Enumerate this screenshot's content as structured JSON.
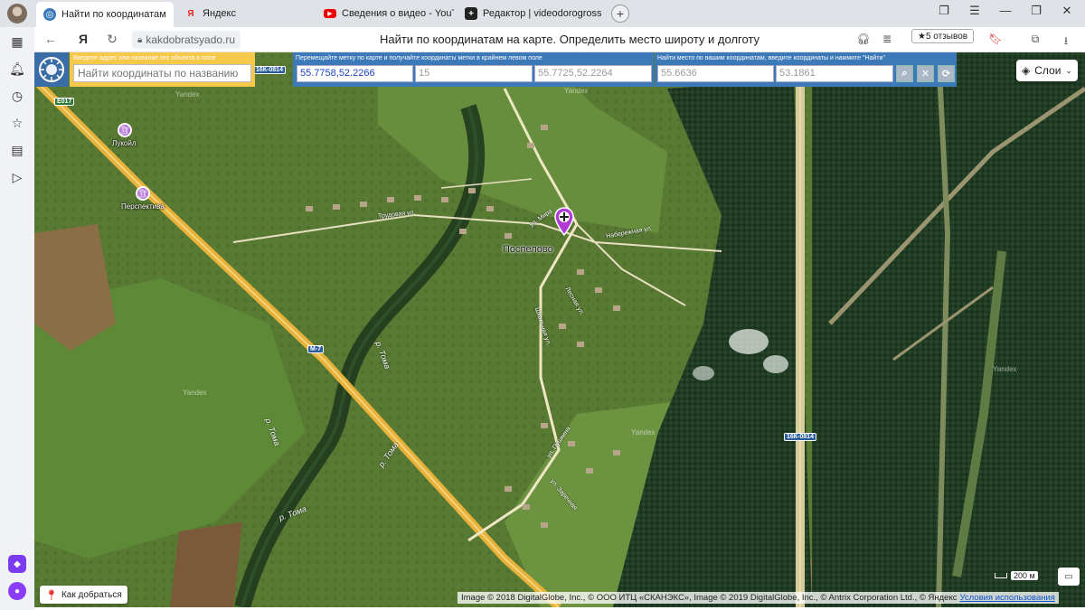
{
  "browser": {
    "tabs": [
      {
        "label": "Найти по координатам",
        "icon": "globe-icon",
        "active": true
      },
      {
        "label": "Яндекс",
        "icon": "yandex-icon",
        "active": false
      },
      {
        "label": "Сведения о видео - YouTu",
        "icon": "youtube-icon",
        "active": false
      },
      {
        "label": "Редактор | videodorogross",
        "icon": "editor-icon",
        "active": false
      }
    ],
    "new_tab_label": "+",
    "url": "kakdobratsyado.ru",
    "page_title": "Найти по координатам на карте. Определить место широту и долготу",
    "reviews": "★5 отзывов",
    "yandex_letter": "Я"
  },
  "toolbar": {
    "search_hint": "Введите адрес или название гео объекта в поле",
    "search_placeholder": "Найти координаты по названию",
    "move_hint": "Перемещайте метку по карте и получайте координаты метки в крайнем левом поле",
    "marker_coords": "55.7758,52.2266",
    "zoom": "15",
    "center_coords": "55.7725,52.2264",
    "find_hint": "Найти место по вашим координатам, введите координаты и нажмите \"Найти\"",
    "lat": "55.6636",
    "lon": "53.1861"
  },
  "map": {
    "layers_label": "Слои",
    "route_label": "Как добраться",
    "scale_label": "200 м",
    "copyright": "Image © 2018 DigitalGlobe, Inc., © ООО ИТЦ «СКАНЭКС», Image © 2019 DigitalGlobe, Inc., © Antrix Corporation Ltd., © Яндекс",
    "terms_link": "Условия использования",
    "labels": {
      "village": "Поспелово",
      "poi_lukoil": "Лукойл",
      "poi_perspektiva": "Перспектива",
      "road_m7": "М-7",
      "road_e017": "E017",
      "road_16k_top": "16К-0814",
      "road_16k_right": "16К-0814",
      "river_1": "р. Тома",
      "river_2": "р. Тома",
      "river_3": "р. Тома",
      "river_4": "р. Тома",
      "street_trudovaya": "Трудовая ул.",
      "street_mira": "ул. Мира",
      "street_naberezhnaya": "Набережная ул.",
      "street_lesnaya": "Лесная ул.",
      "street_pushkina": "ул. Пушкина",
      "street_shkolnaya": "Школьная ул.",
      "street_zarechnaya": "ул. Заречная",
      "yandex_wm": "Yandex"
    }
  }
}
